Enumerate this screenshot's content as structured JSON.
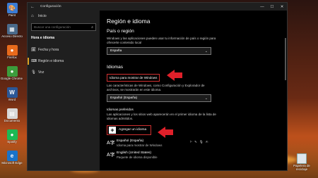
{
  "desktop": {
    "icons": [
      {
        "name": "paint-app-icon",
        "label": "Paint",
        "glyph": "🎨",
        "color": "#3a7bd5"
      },
      {
        "name": "acceso-directo-icon",
        "label": "Acceso Directo",
        "glyph": "▦",
        "color": "#4a6a8a"
      },
      {
        "name": "firefox-icon",
        "label": "Firefox",
        "glyph": "●",
        "color": "#e86a1c"
      },
      {
        "name": "chrome-icon",
        "label": "Google Chrome radios",
        "glyph": "●",
        "color": "#3c9d3c"
      },
      {
        "name": "word-icon",
        "label": "Word",
        "glyph": "W",
        "color": "#2b5797"
      },
      {
        "name": "document-icon",
        "label": "Documento",
        "glyph": "▤",
        "color": "#d8d8d8"
      },
      {
        "name": "spotify-icon",
        "label": "Spotify",
        "glyph": "●",
        "color": "#1db954"
      },
      {
        "name": "microsoft-edge-icon",
        "label": "Microsoft Edge",
        "glyph": "e",
        "color": "#1a73c9"
      }
    ],
    "recycle_label": "Papelera de reciclaje"
  },
  "window": {
    "title": "Configuración",
    "back": "←",
    "minimize": "—",
    "maximize": "☐",
    "close": "✕"
  },
  "nav": {
    "home": "Inicio",
    "search_placeholder": "Buscar una configuración",
    "section": "Hora e idioma",
    "items": [
      {
        "label": "Fecha y hora",
        "icon": "🗓",
        "active": false
      },
      {
        "label": "Región e idioma",
        "icon": "⌨",
        "active": true
      },
      {
        "label": "Voz",
        "icon": "🎙",
        "active": false
      }
    ]
  },
  "content": {
    "title": "Región e idioma",
    "region_heading": "País o región",
    "region_desc": "Windows y las aplicaciones pueden usar tu información de país o región para ofrecerte contenido local",
    "region_value": "España",
    "languages_heading": "Idiomas",
    "display_lang_label": "Idioma para mostrar de Windows",
    "display_lang_desc": "Las características de Windows, como Configuración y Explorador de archivos, se mostrarán en este idioma.",
    "display_lang_value": "Español (España)",
    "preferred_heading": "Idiomas preferidos",
    "preferred_desc": "Las aplicaciones y los sitios web aparecerán en el primer idioma de la lista de idiomas admitidos.",
    "add_language": "Agregar un idioma",
    "languages": [
      {
        "name": "Español (España)",
        "sub": "Idioma para mostrar de Windows",
        "feats": "⚐ ✎ 🎙 ✍"
      },
      {
        "name": "English (United States)",
        "sub": "Paquete de idioma disponible",
        "feats": ""
      }
    ]
  },
  "colors": {
    "accent": "#e0a020",
    "highlight": "#d03030",
    "arrow": "#e0202a"
  }
}
